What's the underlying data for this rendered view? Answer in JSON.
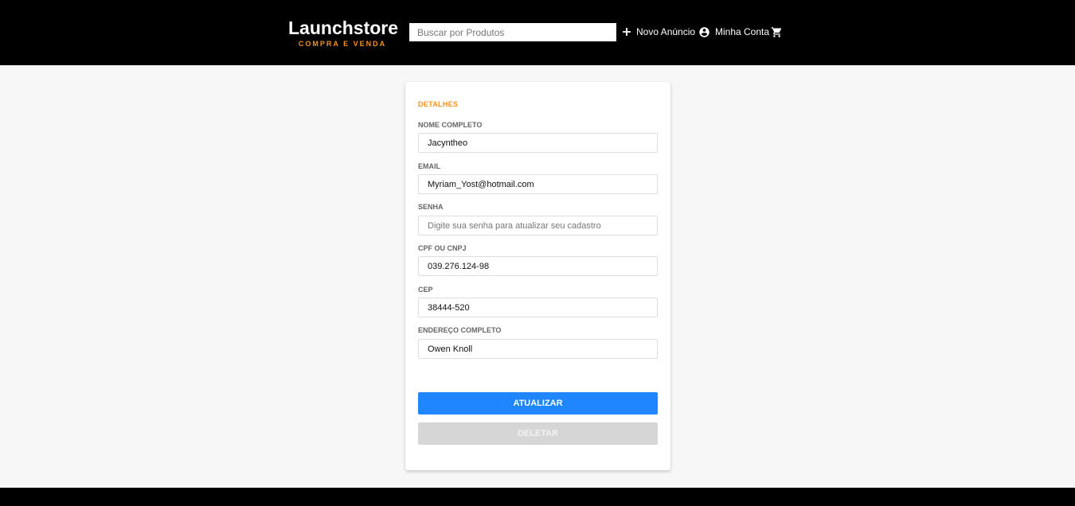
{
  "header": {
    "brand": "Launchstore",
    "tagline": "COMPRA E VENDA",
    "search_placeholder": "Buscar por Produtos",
    "nav": {
      "new_ad_label": "Novo Anúncio",
      "account_label": "Minha Conta"
    },
    "icons": [
      "plus-icon",
      "account-circle-icon",
      "cart-icon"
    ]
  },
  "form": {
    "section_title": "DETALHES",
    "fields": [
      {
        "label": "NOME COMPLETO",
        "value": "Jacyntheo",
        "placeholder": ""
      },
      {
        "label": "EMAIL",
        "value": "Myriam_Yost@hotmail.com",
        "placeholder": ""
      },
      {
        "label": "SENHA",
        "value": "",
        "placeholder": "Digite sua senha para atualizar seu cadastro"
      },
      {
        "label": "CPF OU CNPJ",
        "value": "039.276.124-98",
        "placeholder": ""
      },
      {
        "label": "CEP",
        "value": "38444-520",
        "placeholder": ""
      },
      {
        "label": "ENDEREÇO COMPLETO",
        "value": "Owen Knoll",
        "placeholder": ""
      }
    ],
    "update_label": "ATUALIZAR",
    "delete_label": "DELETAR"
  },
  "colors": {
    "header_bg": "#000000",
    "accent_orange": "#f7911e",
    "primary_blue": "#1f86ff",
    "disabled_gray": "#d6d6d6"
  }
}
